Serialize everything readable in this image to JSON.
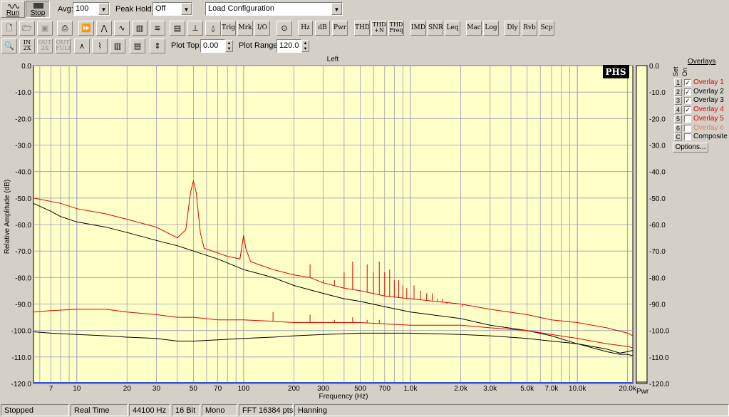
{
  "toolbar1": {
    "run_label": "Run",
    "stop_label": "Stop",
    "avg_label": "Avg:",
    "avg_value": "100",
    "peak_hold_label": "Peak Hold:",
    "peak_hold_value": "Off",
    "config_value": "Load Configuration"
  },
  "toolbar2": {
    "buttons": [
      "Trig",
      "Mrk",
      "I/O",
      "Hz",
      "dB",
      "Pwr",
      "THD",
      "THD +N",
      "THD Freq",
      "IMD",
      "SNR",
      "Leq",
      "Mac",
      "Log",
      "Dly",
      "Rvb",
      "Scp"
    ],
    "icons": [
      "new-file-icon",
      "open-folder-icon",
      "save-icon",
      "print-icon",
      "fast-forward-icon",
      "spectrum-icon",
      "waveform-icon",
      "bars-icon",
      "waterfall-icon",
      "panel-icon",
      "spectrum-peak-icon",
      "bell-icon",
      "sine-generator-icon"
    ]
  },
  "toolbar3": {
    "zoom_in_label": "IN 2X",
    "zoom_out_label": "OUT 2X",
    "zoom_full_label": "OUT FULL",
    "plot_top_label": "Plot Top:",
    "plot_top_value": "0.00",
    "plot_range_label": "Plot Range:",
    "plot_range_value": "120.0"
  },
  "plot": {
    "channel_title": "Left",
    "logo": "PHS",
    "pwr_label": "Pwr",
    "colors": {
      "bg": "#ffffc8",
      "grid": "#9a9ab4",
      "red": "#e00000",
      "black": "#000000",
      "bottom_line": "#3050d8"
    }
  },
  "chart_data": {
    "type": "line",
    "title": "Left",
    "xlabel": "Frequency (Hz)",
    "ylabel": "Relative Amplitude (dB)",
    "x_scale": "log",
    "xlim": [
      5.5,
      21500
    ],
    "ylim": [
      -120,
      0
    ],
    "grid": true,
    "y_ticks": [
      "0.0",
      "-10.0",
      "-20.0",
      "-30.0",
      "-40.0",
      "-50.0",
      "-60.0",
      "-70.0",
      "-80.0",
      "-90.0",
      "-100.0",
      "-110.0",
      "-120.0"
    ],
    "x_ticks": [
      {
        "value": 7,
        "label": "7"
      },
      {
        "value": 10,
        "label": "10"
      },
      {
        "value": 20,
        "label": "20"
      },
      {
        "value": 30,
        "label": "30"
      },
      {
        "value": 50,
        "label": "50"
      },
      {
        "value": 70,
        "label": "70"
      },
      {
        "value": 100,
        "label": "100"
      },
      {
        "value": 200,
        "label": "200"
      },
      {
        "value": 300,
        "label": "300"
      },
      {
        "value": 500,
        "label": "500"
      },
      {
        "value": 700,
        "label": "700"
      },
      {
        "value": 1000,
        "label": "1.0k"
      },
      {
        "value": 2000,
        "label": "2.0k"
      },
      {
        "value": 3000,
        "label": "3.0k"
      },
      {
        "value": 5000,
        "label": "5.0k"
      },
      {
        "value": 7000,
        "label": "7.0k"
      },
      {
        "value": 10000,
        "label": "10.0k"
      },
      {
        "value": 20000,
        "label": "20.0k"
      }
    ],
    "series": [
      {
        "name": "Overlay 1",
        "color": "#e00000",
        "points": [
          [
            5.5,
            -50
          ],
          [
            8,
            -52
          ],
          [
            10,
            -54
          ],
          [
            15,
            -56
          ],
          [
            20,
            -58
          ],
          [
            30,
            -61
          ],
          [
            40,
            -65
          ],
          [
            45,
            -62
          ],
          [
            48,
            -48
          ],
          [
            50,
            -43.5
          ],
          [
            52,
            -48
          ],
          [
            55,
            -63
          ],
          [
            58,
            -69
          ],
          [
            65,
            -70
          ],
          [
            80,
            -72
          ],
          [
            95,
            -73
          ],
          [
            100,
            -64
          ],
          [
            103,
            -69
          ],
          [
            110,
            -74
          ],
          [
            150,
            -77
          ],
          [
            200,
            -79
          ],
          [
            250,
            -80
          ],
          [
            300,
            -82
          ],
          [
            400,
            -84
          ],
          [
            500,
            -85
          ],
          [
            700,
            -87
          ],
          [
            1000,
            -88
          ],
          [
            2000,
            -90
          ],
          [
            3000,
            -92
          ],
          [
            5000,
            -94
          ],
          [
            7000,
            -96
          ],
          [
            10000,
            -97
          ],
          [
            15000,
            -99
          ],
          [
            20000,
            -101
          ],
          [
            21500,
            -102
          ]
        ],
        "spikes": [
          [
            200,
            -78.5
          ],
          [
            250,
            -75
          ],
          [
            300,
            -81
          ],
          [
            350,
            -81
          ],
          [
            400,
            -78
          ],
          [
            450,
            -74
          ],
          [
            550,
            -75
          ],
          [
            600,
            -78
          ],
          [
            650,
            -74
          ],
          [
            700,
            -78
          ],
          [
            750,
            -77
          ],
          [
            800,
            -81
          ],
          [
            850,
            -81
          ],
          [
            900,
            -83
          ],
          [
            950,
            -84
          ],
          [
            1050,
            -83
          ],
          [
            1150,
            -85
          ],
          [
            1250,
            -86
          ],
          [
            1350,
            -86
          ],
          [
            1450,
            -88
          ],
          [
            1550,
            -88
          ],
          [
            1650,
            -90
          ],
          [
            1850,
            -90
          ],
          [
            2050,
            -91
          ]
        ]
      },
      {
        "name": "Overlay 2",
        "color": "#000000",
        "points": [
          [
            5.5,
            -52
          ],
          [
            7,
            -55
          ],
          [
            8,
            -57
          ],
          [
            10,
            -59
          ],
          [
            15,
            -61
          ],
          [
            20,
            -63
          ],
          [
            30,
            -66
          ],
          [
            40,
            -68
          ],
          [
            50,
            -70
          ],
          [
            70,
            -73
          ],
          [
            100,
            -77
          ],
          [
            150,
            -80
          ],
          [
            200,
            -83
          ],
          [
            300,
            -86
          ],
          [
            400,
            -88
          ],
          [
            500,
            -89
          ],
          [
            700,
            -91
          ],
          [
            1000,
            -93
          ],
          [
            2000,
            -95.5
          ],
          [
            3000,
            -98
          ],
          [
            5000,
            -100
          ],
          [
            7000,
            -102
          ],
          [
            10000,
            -105
          ],
          [
            15000,
            -108
          ],
          [
            18000,
            -109
          ],
          [
            20000,
            -109
          ],
          [
            21500,
            -109.5
          ]
        ]
      },
      {
        "name": "Overlay 3",
        "color": "#e00000",
        "points": [
          [
            5.5,
            -93
          ],
          [
            7,
            -92.5
          ],
          [
            10,
            -92
          ],
          [
            15,
            -92
          ],
          [
            20,
            -93
          ],
          [
            30,
            -94
          ],
          [
            40,
            -95
          ],
          [
            50,
            -95
          ],
          [
            70,
            -96
          ],
          [
            100,
            -96
          ],
          [
            150,
            -96.5
          ],
          [
            200,
            -97
          ],
          [
            300,
            -97
          ],
          [
            500,
            -97
          ],
          [
            700,
            -97.5
          ],
          [
            1000,
            -98
          ],
          [
            2000,
            -98
          ],
          [
            3000,
            -99
          ],
          [
            5000,
            -100
          ],
          [
            7000,
            -101.5
          ],
          [
            10000,
            -103
          ],
          [
            15000,
            -105
          ],
          [
            20000,
            -106
          ],
          [
            21500,
            -106.5
          ]
        ],
        "spikes": [
          [
            30,
            -94
          ],
          [
            150,
            -93
          ],
          [
            250,
            -94
          ],
          [
            300,
            -97
          ],
          [
            350,
            -96
          ],
          [
            450,
            -95
          ],
          [
            550,
            -96
          ],
          [
            650,
            -96
          ]
        ]
      },
      {
        "name": "Overlay 4",
        "color": "#000000",
        "points": [
          [
            5.5,
            -100.5
          ],
          [
            7,
            -101
          ],
          [
            10,
            -101.5
          ],
          [
            15,
            -102
          ],
          [
            20,
            -102.5
          ],
          [
            30,
            -103
          ],
          [
            40,
            -104
          ],
          [
            50,
            -104
          ],
          [
            70,
            -103.5
          ],
          [
            100,
            -103
          ],
          [
            150,
            -102.5
          ],
          [
            200,
            -102
          ],
          [
            300,
            -101.5
          ],
          [
            500,
            -101
          ],
          [
            700,
            -101
          ],
          [
            1000,
            -101
          ],
          [
            2000,
            -101.5
          ],
          [
            3000,
            -102
          ],
          [
            5000,
            -103
          ],
          [
            7000,
            -104
          ],
          [
            10000,
            -105
          ],
          [
            15000,
            -107
          ],
          [
            18000,
            -108.5
          ],
          [
            20000,
            -108
          ],
          [
            21500,
            -107.5
          ]
        ]
      }
    ]
  },
  "overlays": {
    "title": "Overlays",
    "col_set": "Set",
    "col_on": "On",
    "items": [
      {
        "num": "1",
        "label": "Overlay 1",
        "checked": true,
        "color": "#e00000"
      },
      {
        "num": "2",
        "label": "Overlay 2",
        "checked": true,
        "color": "#000000"
      },
      {
        "num": "3",
        "label": "Overlay 3",
        "checked": true,
        "color": "#000000"
      },
      {
        "num": "4",
        "label": "Overlay 4",
        "checked": true,
        "color": "#e00000"
      },
      {
        "num": "5",
        "label": "Overlay 5",
        "checked": false,
        "color": "#e00000"
      },
      {
        "num": "6",
        "label": "Overlay 6",
        "checked": false,
        "color": "#e08060"
      },
      {
        "num": "C",
        "label": "Composite",
        "checked": false,
        "color": "#000000"
      }
    ],
    "options_label": "Options..."
  },
  "status": {
    "state": "Stopped",
    "mode": "Real Time",
    "rate": "44100 Hz",
    "bits": "16 Bit",
    "channels": "Mono",
    "fft": "FFT 16384 pts",
    "window": "Hanning"
  }
}
